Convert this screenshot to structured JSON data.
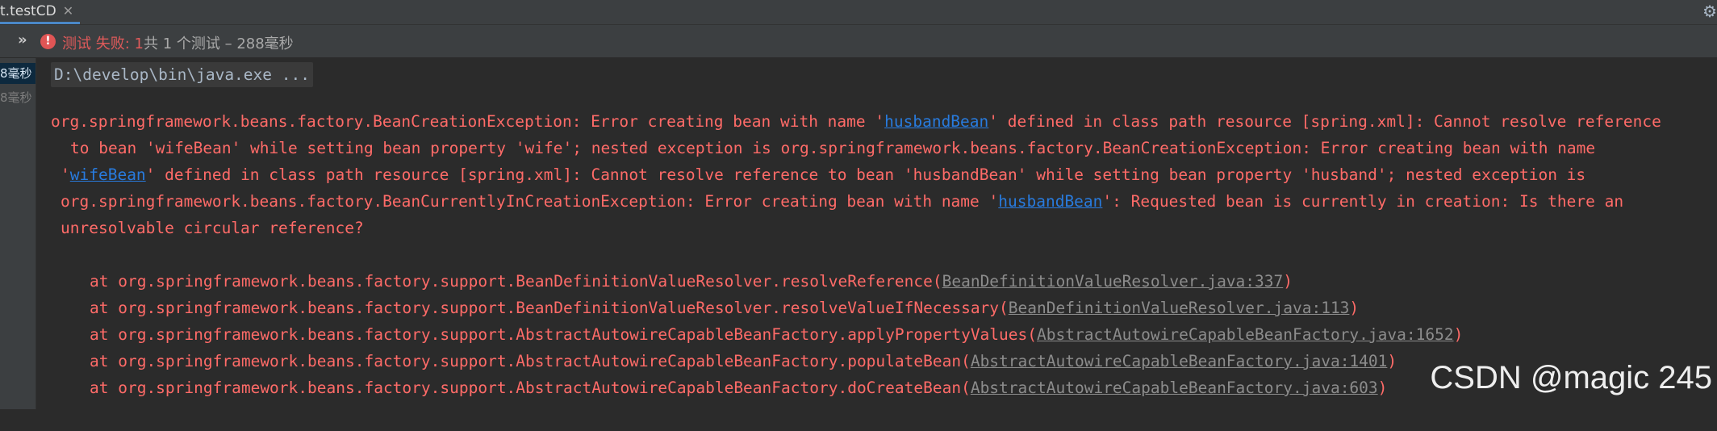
{
  "tab": {
    "label": "t.testCD",
    "close_glyph": "✕"
  },
  "status": {
    "expand_glyph": "»",
    "failed_label": "测试 失败:",
    "count": "1",
    "rest": "共 1 个测试 – 288毫秒"
  },
  "tree": {
    "items": [
      "8毫秒",
      "8毫秒"
    ]
  },
  "console": {
    "command": "D:\\develop\\bin\\java.exe ...",
    "exception": {
      "l1_a": "org.springframework.beans.factory.BeanCreationException: Error creating bean with name '",
      "l1_link": "husbandBean",
      "l1_b": "' defined in class path resource [spring.xml]: Cannot resolve reference",
      "l2": "to bean 'wifeBean' while setting bean property 'wife'; nested exception is org.springframework.beans.factory.BeanCreationException: Error creating bean with name",
      "l3_a": "'",
      "l3_link": "wifeBean",
      "l3_b": "' defined in class path resource [spring.xml]: Cannot resolve reference to bean 'husbandBean' while setting bean property 'husband'; nested exception is",
      "l4_a": "org.springframework.beans.factory.BeanCurrentlyInCreationException: Error creating bean with name '",
      "l4_link": "husbandBean",
      "l4_b": "': Requested bean is currently in creation: Is there an",
      "l5": "unresolvable circular reference?"
    },
    "stack": [
      {
        "prefix": "at org.springframework.beans.factory.support.BeanDefinitionValueResolver.resolveReference(",
        "source": "BeanDefinitionValueResolver.java:337",
        "suffix": ")"
      },
      {
        "prefix": "at org.springframework.beans.factory.support.BeanDefinitionValueResolver.resolveValueIfNecessary(",
        "source": "BeanDefinitionValueResolver.java:113",
        "suffix": ")"
      },
      {
        "prefix": "at org.springframework.beans.factory.support.AbstractAutowireCapableBeanFactory.applyPropertyValues(",
        "source": "AbstractAutowireCapableBeanFactory.java:1652",
        "suffix": ")"
      },
      {
        "prefix": "at org.springframework.beans.factory.support.AbstractAutowireCapableBeanFactory.populateBean(",
        "source": "AbstractAutowireCapableBeanFactory.java:1401",
        "suffix": ")"
      },
      {
        "prefix": "at org.springframework.beans.factory.support.AbstractAutowireCapableBeanFactory.doCreateBean(",
        "source": "AbstractAutowireCapableBeanFactory.java:603",
        "suffix": ")"
      }
    ]
  },
  "watermark": "CSDN @magic 245",
  "icons": {
    "gear": "gear-icon",
    "error": "error-icon",
    "expand": "expand-icon"
  },
  "colors": {
    "error": "#ff6b68",
    "link": "#287bde",
    "source_link": "#8c8c8c",
    "background": "#2b2b2b"
  }
}
